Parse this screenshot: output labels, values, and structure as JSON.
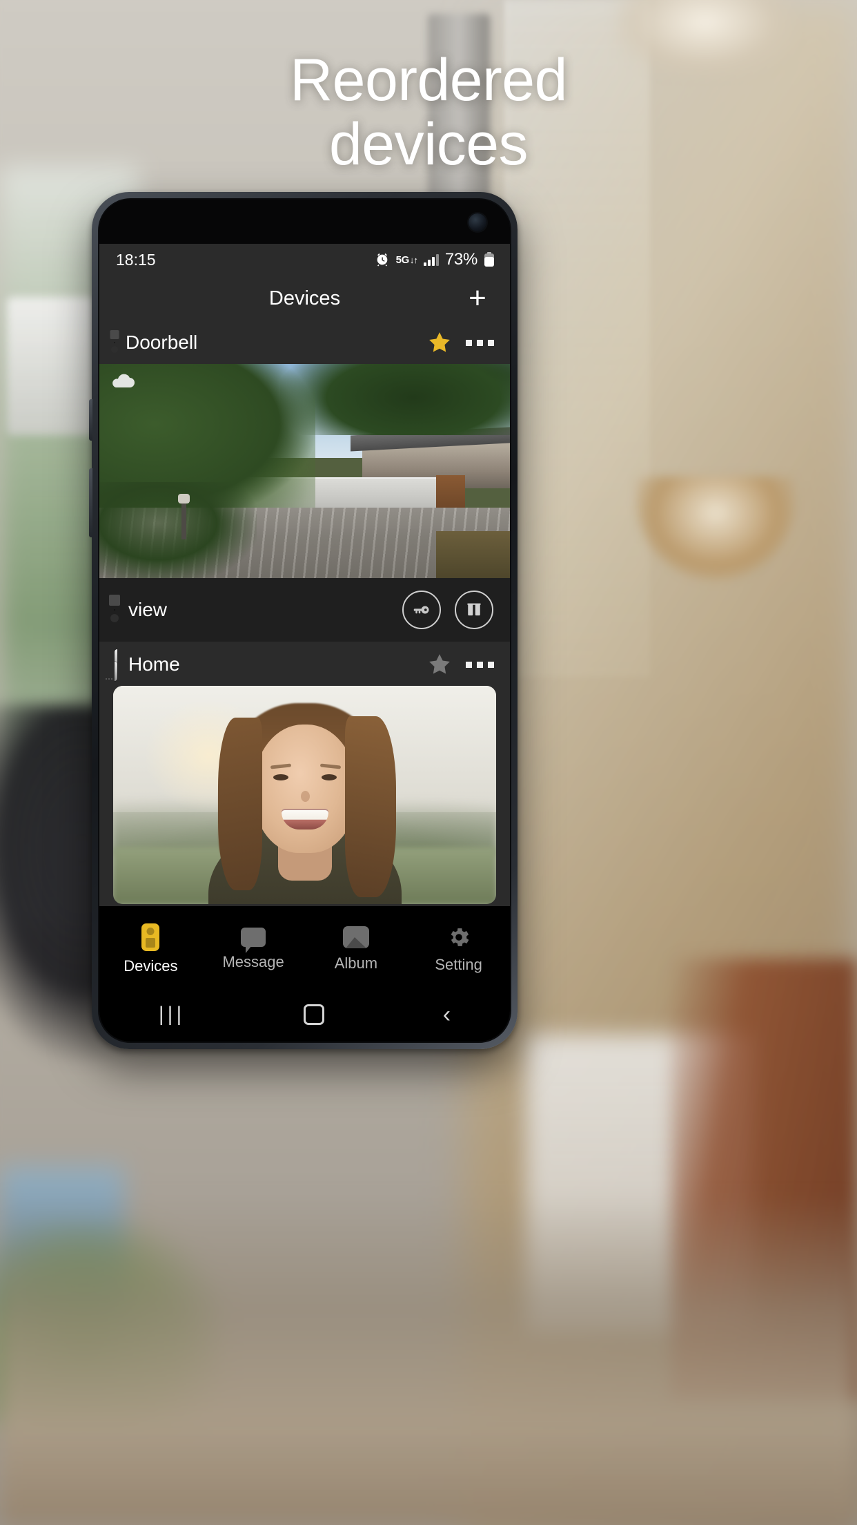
{
  "headline": {
    "line1": "Reordered",
    "line2": "devices"
  },
  "status_bar": {
    "time": "18:15",
    "alarm_icon": "alarm-clock-icon",
    "network_label": "5G",
    "network_arrows": "↓↑",
    "signal_icon": "signal-bars-icon",
    "battery_percent": "73%",
    "battery_icon": "battery-icon"
  },
  "app_bar": {
    "title": "Devices",
    "add_label": "+"
  },
  "devices": [
    {
      "name": "Doorbell",
      "icon": "doorbell-device-icon",
      "favorite": true,
      "star_color": "#e9b828",
      "menu_icon": "more-options-icon",
      "preview": "doorbell-camera-preview",
      "preview_badge": "cloud-icon",
      "control": {
        "icon": "doorbell-device-icon",
        "label": "view",
        "buttons": [
          {
            "name": "unlock-button",
            "icon": "key-icon"
          },
          {
            "name": "gate-button",
            "icon": "gate-icon"
          }
        ]
      }
    },
    {
      "name": "Home",
      "icon": "indoor-monitor-icon",
      "favorite": false,
      "star_color": "#7a7a7a",
      "menu_icon": "more-options-icon",
      "preview": "home-portrait-preview"
    }
  ],
  "bottom_nav": [
    {
      "label": "Devices",
      "icon": "doorbell-icon",
      "active": true
    },
    {
      "label": "Message",
      "icon": "message-icon",
      "active": false
    },
    {
      "label": "Album",
      "icon": "album-icon",
      "active": false
    },
    {
      "label": "Setting",
      "icon": "gear-icon",
      "active": false
    }
  ],
  "android_nav": {
    "recents": "|||",
    "home": "home-square-icon",
    "back": "‹"
  },
  "colors": {
    "accent": "#e8b923",
    "screen_bg": "#2b2b2b",
    "card_bg": "#1f1f1f",
    "nav_bg": "#000000"
  }
}
